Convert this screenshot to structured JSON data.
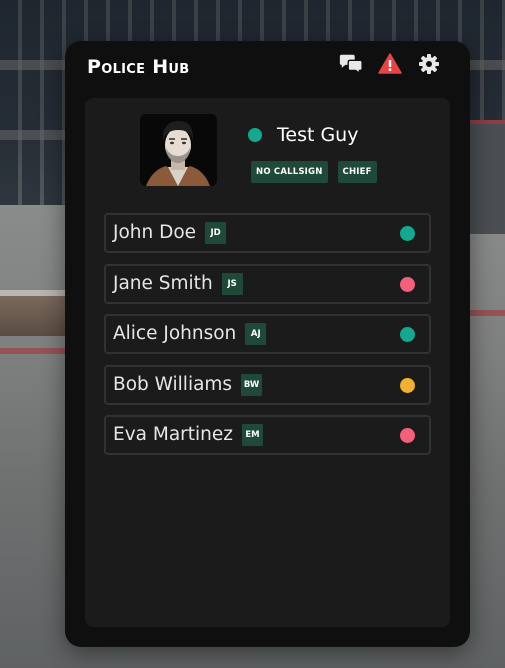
{
  "header": {
    "title": "Police Hub",
    "icons": [
      "chat-icon",
      "alert-icon",
      "settings-icon"
    ]
  },
  "profile": {
    "name": "Test Guy",
    "status_color": "#15a88f",
    "tags": [
      "NO CALLSIGN",
      "CHIEF"
    ]
  },
  "roster": [
    {
      "name": "John Doe",
      "initials": "JD",
      "status_color": "#15a88f"
    },
    {
      "name": "Jane Smith",
      "initials": "JS",
      "status_color": "#f2607a"
    },
    {
      "name": "Alice Johnson",
      "initials": "AJ",
      "status_color": "#15a88f"
    },
    {
      "name": "Bob Williams",
      "initials": "BW",
      "status_color": "#f0b030"
    },
    {
      "name": "Eva Martinez",
      "initials": "EM",
      "status_color": "#f2607a"
    }
  ],
  "colors": {
    "panel_bg": "#0f0f10",
    "body_bg": "#1b1b1c",
    "tag_bg": "#1f4a3a",
    "alert_red": "#e64545",
    "online": "#15a88f",
    "busy": "#f2607a",
    "away": "#f0b030"
  }
}
